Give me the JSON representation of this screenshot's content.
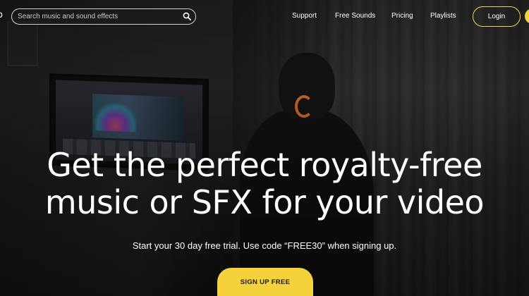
{
  "header": {
    "logo_fragment": "o",
    "search": {
      "placeholder": "Search music and sound effects",
      "icon": "search-icon"
    },
    "nav": [
      {
        "label": "Support"
      },
      {
        "label": "Free Sounds"
      },
      {
        "label": "Pricing"
      },
      {
        "label": "Playlists"
      }
    ],
    "login_label": "Login"
  },
  "hero": {
    "headline_line1": "Get the perfect royalty-free",
    "headline_line2": "music or SFX for your video",
    "subtext": "Start your 30 day free trial. Use code “FREE30” when signing up.",
    "cta_label": "SIGN UP FREE"
  },
  "colors": {
    "accent": "#f5d13c",
    "text": "#ffffff",
    "background": "#1c1c1c"
  }
}
